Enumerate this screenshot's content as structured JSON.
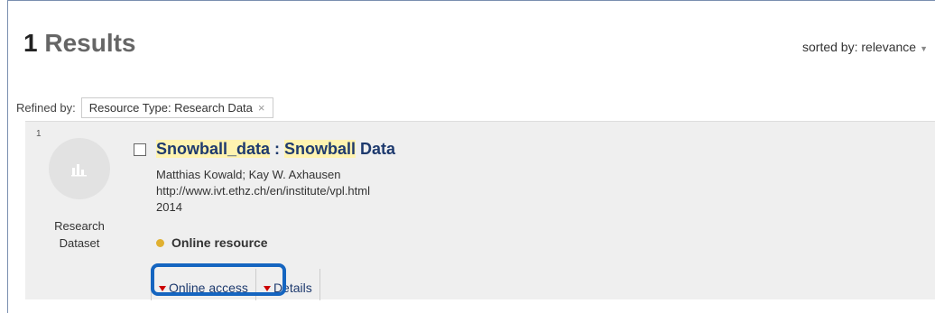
{
  "results": {
    "count": "1",
    "word": "Results"
  },
  "sort": {
    "label": "sorted by: relevance",
    "icon": "caret-down-icon"
  },
  "refined": {
    "label": "Refined by:",
    "chip_label": "Resource Type: Research Data",
    "chip_close": "×"
  },
  "result": {
    "rank": "1",
    "type_icon": "bar-chart-icon",
    "type_label_line1": "Research",
    "type_label_line2": "Dataset",
    "title_part1": "Snowball_data",
    "title_sep": " : ",
    "title_part2": "Snowball",
    "title_part3": " Data",
    "authors": "Matthias Kowald; Kay W. Axhausen",
    "url": "http://www.ivt.ethz.ch/en/institute/vpl.html",
    "year": "2014",
    "availability": "Online resource",
    "tabs": [
      {
        "label": "Online access"
      },
      {
        "label": "Details"
      }
    ]
  },
  "colors": {
    "title": "#1e3a6e",
    "highlight": "#fff3b0",
    "availability_dot": "#e0b030",
    "tab_triangle": "#cc0000",
    "annotation_box": "#1565c0"
  }
}
